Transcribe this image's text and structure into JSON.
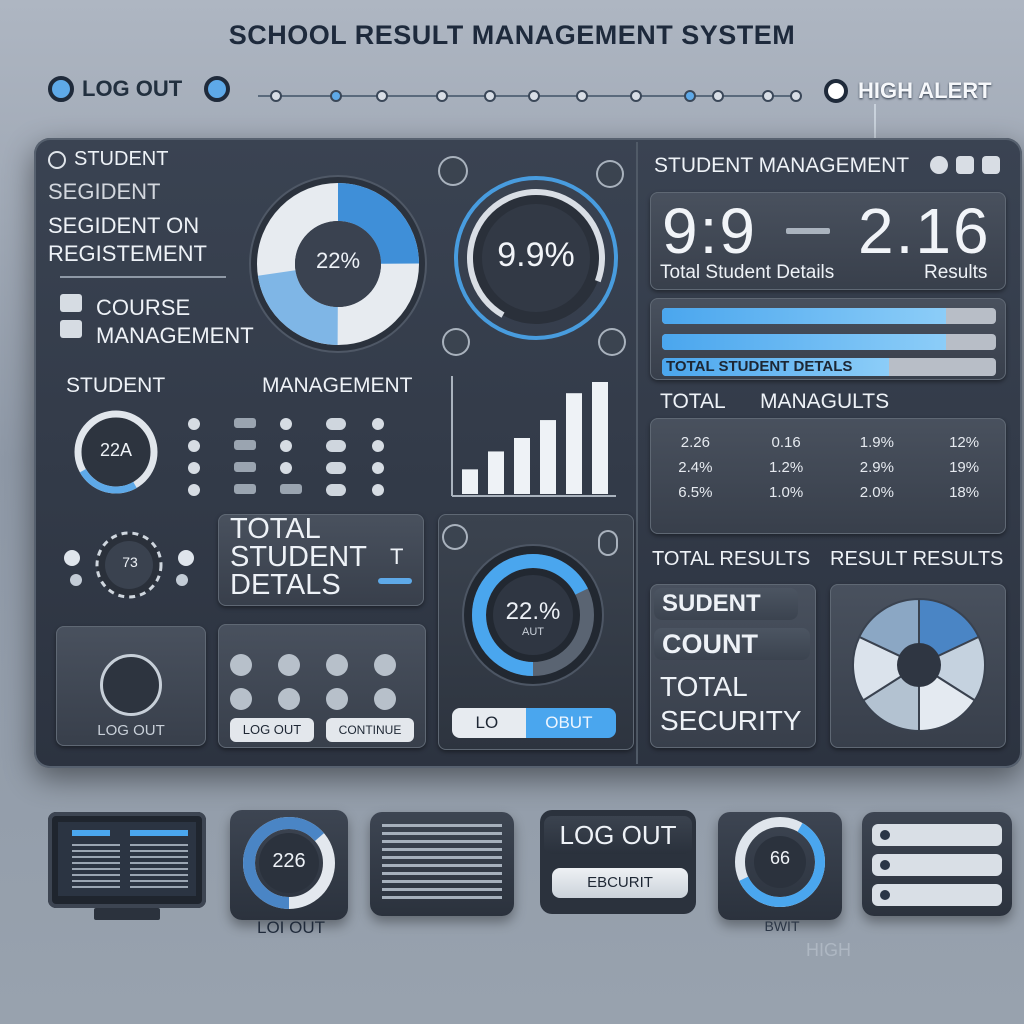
{
  "app": {
    "title": "SCHOOL RESULT MANAGEMENT SYSTEM"
  },
  "topbar": {
    "logout_label": "LOG OUT",
    "alert_label": "HIGH ALERT"
  },
  "sidebar": {
    "items": [
      {
        "label": "STUDENT"
      },
      {
        "label": "SEGIDENT"
      },
      {
        "label": "SEGIDENT ON"
      },
      {
        "label": "REGISTEMENT"
      },
      {
        "label": "COURSE"
      },
      {
        "label": "MANAGEMENT"
      }
    ]
  },
  "donut_main": {
    "value_label": "22%",
    "color": "#3f8fd8"
  },
  "gauge": {
    "value_label": "9.9%",
    "sub_label": "",
    "color": "#4aa6ee"
  },
  "student_mgmt": {
    "title": "STUDENT MANAGEMENT",
    "kpi_left": "9:9",
    "kpi_left_label": "Total Student Details",
    "kpi_right": "2.16",
    "kpi_right_label": "Results",
    "progress_bars": [
      {
        "label": "",
        "value": 0.85
      },
      {
        "label": "",
        "value": 0.85
      },
      {
        "label": "TOTAL STUDENT DETALS",
        "value": 0.68
      }
    ],
    "progress_label": "TOTAL STUDENT DETALS",
    "table_title_left": "TOTAL",
    "table_title_right": "MANAGULTS",
    "table_rows": [
      [
        "",
        "",
        "",
        ""
      ],
      [
        "2.26",
        "0.16",
        "1.9%",
        "12%"
      ],
      [
        "2.4%",
        "1.2%",
        "2.9%",
        "19%"
      ],
      [
        "6.5%",
        "1.0%",
        "2.0%",
        "18%"
      ]
    ]
  },
  "mid": {
    "title_left": "STUDENT",
    "title_right": "MANAGEMENT",
    "small_gauge_label": "22A",
    "bar_chart": {
      "values": [
        22,
        38,
        50,
        66,
        90,
        100
      ]
    }
  },
  "total_details": {
    "line1": "TOTAL",
    "line2": "STUDENT",
    "line3": "DETALS",
    "badge": "T"
  },
  "wreath": {
    "label": "73"
  },
  "donut_lower": {
    "value_label": "22.%",
    "sub_label": "AUT"
  },
  "lower_buttons": {
    "logout": "LOG OUT",
    "log_out_left": "LOG OUT",
    "counter": "CONTINUE"
  },
  "toggle": {
    "left_label": "LO",
    "right_label": "OBUT"
  },
  "results": {
    "title_left": "TOTAL RESULTS",
    "title_right": "RESULT RESULTS",
    "stack": [
      "SUDENT",
      "COUNT",
      "TOTAL SECURITY"
    ]
  },
  "pie": {
    "slices": [
      0.18,
      0.16,
      0.16,
      0.16,
      0.16,
      0.18
    ],
    "colors": [
      "#4a85c5",
      "#c5d2df",
      "#e4eaf1",
      "#b3c2d1",
      "#dbe3ec",
      "#8ba7c4"
    ]
  },
  "bottom": {
    "monitor_label": "",
    "donut_label": "226",
    "donut_caption": "LOI OUT",
    "logout_label": "LOG OUT",
    "security_label": "EBCURIT",
    "gauge_label": "66",
    "gauge_caption": "BWIT",
    "list_items": [
      "",
      "",
      ""
    ],
    "faint_caption": "HIGH"
  }
}
